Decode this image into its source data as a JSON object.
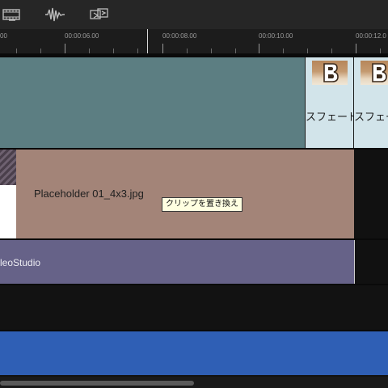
{
  "toolbar": {
    "icons": [
      "filmstrip-icon",
      "audio-waveform-icon",
      "swap-clip-icon"
    ]
  },
  "ruler": {
    "labels": [
      "00",
      "00:00:06.00",
      "00:00:08.00",
      "00:00:10.00",
      "00:00:12.0"
    ]
  },
  "video_track": {
    "transitions": [
      {
        "label": "スフェード-"
      },
      {
        "label": "スフェー"
      }
    ]
  },
  "overlay_track": {
    "clip_name": "Placeholder 01_4x3.jpg",
    "tooltip": "クリップを置き換え"
  },
  "title_track": {
    "clip_name": "leoStudio"
  },
  "colors": {
    "video_clip": "#5c7e82",
    "transition": "#d2e4ea",
    "overlay_clip": "#a38478",
    "title_clip": "#666288",
    "audio_clip": "#2f5fb5"
  }
}
